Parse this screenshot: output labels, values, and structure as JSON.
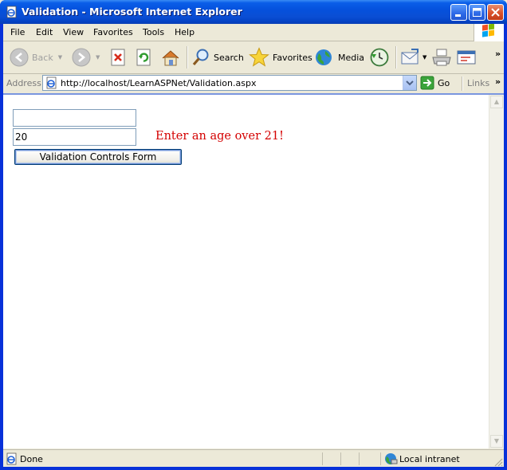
{
  "window": {
    "title": "Validation - Microsoft Internet Explorer"
  },
  "menu": {
    "items": [
      "File",
      "Edit",
      "View",
      "Favorites",
      "Tools",
      "Help"
    ]
  },
  "toolbar": {
    "back_label": "Back",
    "search_label": "Search",
    "favorites_label": "Favorites",
    "media_label": "Media"
  },
  "address": {
    "label": "Address",
    "url": "http://localhost/LearnASPNet/Validation.aspx",
    "go_label": "Go",
    "links_label": "Links"
  },
  "page": {
    "field1_value": "",
    "field2_value": "20",
    "validator_message": "Enter an age over 21!",
    "submit_label": "Validation Controls Form"
  },
  "status": {
    "text": "Done",
    "zone": "Local intranet"
  },
  "colors": {
    "title_bar": "#0a5ee8",
    "validator_text": "#d40000",
    "input_border": "#7f9db9"
  }
}
